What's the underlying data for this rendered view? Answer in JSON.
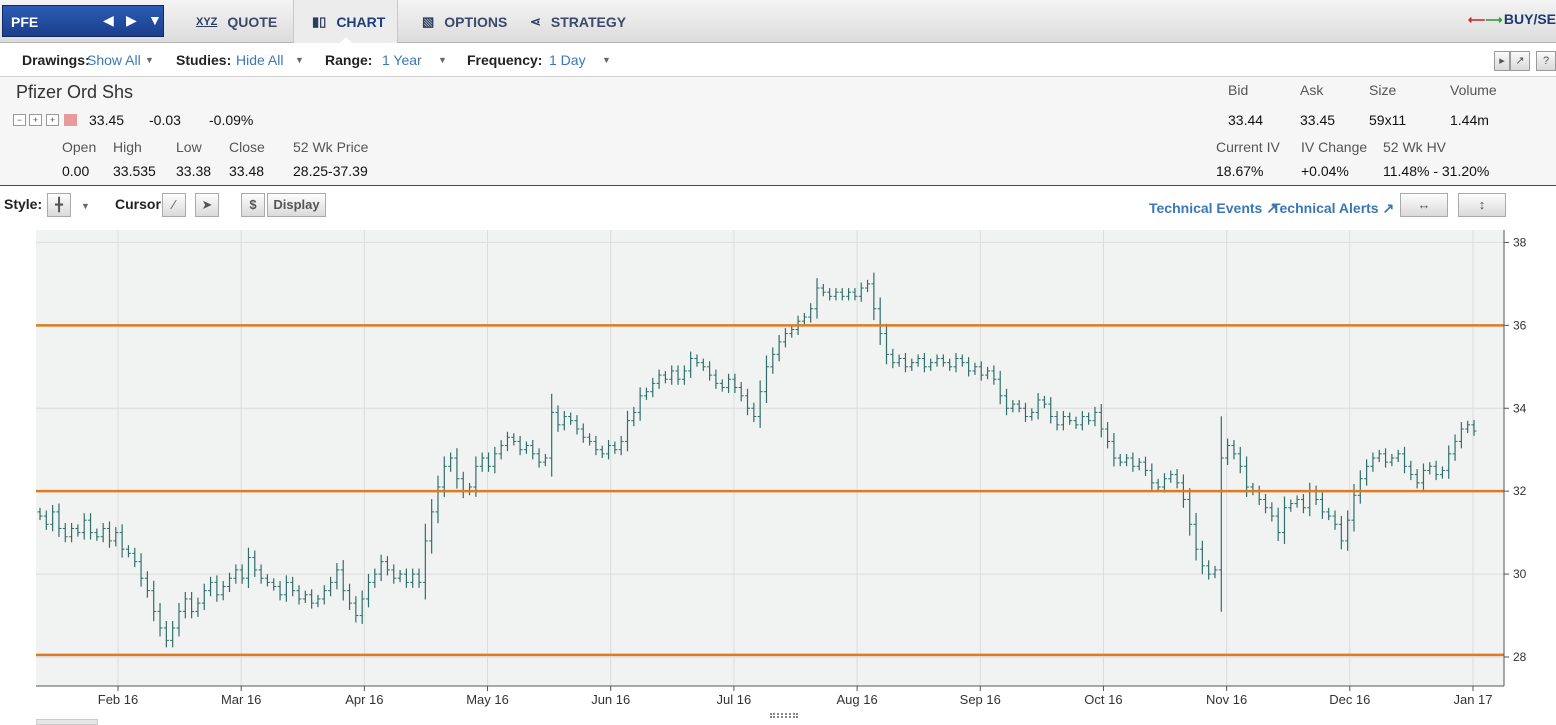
{
  "symbol": {
    "ticker": "PFE"
  },
  "nav": {
    "tabs": [
      {
        "label": "QUOTE",
        "icon": "xyz-quote-icon",
        "active": false
      },
      {
        "label": "CHART",
        "icon": "bar-chart-icon",
        "active": true
      },
      {
        "label": "OPTIONS",
        "icon": "options-icon",
        "active": false
      },
      {
        "label": "STRATEGY",
        "icon": "strategy-icon",
        "active": false
      }
    ],
    "buy_sell": "BUY/SEL"
  },
  "toolbar": {
    "drawings_label": "Drawings:",
    "drawings_value": "Show All",
    "studies_label": "Studies:",
    "studies_value": "Hide All",
    "range_label": "Range:",
    "range_value": "1 Year",
    "frequency_label": "Frequency:",
    "frequency_value": "1 Day"
  },
  "quote": {
    "name": "Pfizer Ord Shs",
    "last": "33.45",
    "change": "-0.03",
    "change_pct": "-0.09%",
    "open_label": "Open",
    "open": "0.00",
    "high_label": "High",
    "high": "33.535",
    "low_label": "Low",
    "low": "33.38",
    "close_label": "Close",
    "close": "33.48",
    "wk52_label": "52 Wk Price",
    "wk52": "28.25-37.39",
    "bid_label": "Bid",
    "bid": "33.44",
    "ask_label": "Ask",
    "ask": "33.45",
    "size_label": "Size",
    "size": "59x11",
    "volume_label": "Volume",
    "volume": "1.44m",
    "iv_label": "Current IV",
    "iv": "18.67%",
    "ivchg_label": "IV Change",
    "ivchg": "+0.04%",
    "hv_label": "52 Wk HV",
    "hv": "11.48% - 31.20%"
  },
  "chart_tools": {
    "style_label": "Style:",
    "cursor_label": "Cursor:",
    "dollar_label": "$",
    "display_label": "Display",
    "technical_events": "Technical Events",
    "technical_alerts": "Technical Alerts"
  },
  "colors": {
    "bar": "#2f6f6a",
    "line": "#e07a22",
    "plot_bg": "#f1f2f2",
    "grid": "#dcdcdc"
  },
  "chart_data": {
    "type": "ohlc",
    "ylim": [
      27.3,
      38.3
    ],
    "yticks": [
      28,
      30,
      32,
      34,
      36,
      38
    ],
    "xticks": [
      "Feb 16",
      "Mar 16",
      "Apr 16",
      "May 16",
      "Jun 16",
      "Jul 16",
      "Aug 16",
      "Sep 16",
      "Oct 16",
      "Nov 16",
      "Dec 16",
      "Jan 17"
    ],
    "horizontal_lines": [
      36.0,
      32.0,
      28.05
    ],
    "closes": [
      31.4,
      31.2,
      31.5,
      31.1,
      30.9,
      31.1,
      31.0,
      31.3,
      31.0,
      30.9,
      31.1,
      30.8,
      31.0,
      30.6,
      30.5,
      30.3,
      29.9,
      29.6,
      29.1,
      28.7,
      28.4,
      28.7,
      29.1,
      29.4,
      29.1,
      29.3,
      29.6,
      29.8,
      29.5,
      29.7,
      29.9,
      30.1,
      29.9,
      30.4,
      30.1,
      29.9,
      29.8,
      29.7,
      29.5,
      29.8,
      29.6,
      29.4,
      29.5,
      29.3,
      29.4,
      29.6,
      29.8,
      30.1,
      29.6,
      29.3,
      29.0,
      29.4,
      29.8,
      30.0,
      30.3,
      30.1,
      29.9,
      30.0,
      29.8,
      30.0,
      29.8,
      30.8,
      31.5,
      32.1,
      32.6,
      32.8,
      32.3,
      32.0,
      32.1,
      32.6,
      32.8,
      32.6,
      32.9,
      33.1,
      33.3,
      33.2,
      33.0,
      33.1,
      32.9,
      32.7,
      32.8,
      33.9,
      33.6,
      33.8,
      33.7,
      33.5,
      33.3,
      33.2,
      33.0,
      32.9,
      33.1,
      33.0,
      33.2,
      33.7,
      33.9,
      34.3,
      34.4,
      34.6,
      34.8,
      34.7,
      34.9,
      34.7,
      34.9,
      35.2,
      35.1,
      35.0,
      34.8,
      34.6,
      34.5,
      34.7,
      34.5,
      34.3,
      34.0,
      33.8,
      34.4,
      35.0,
      35.3,
      35.6,
      35.8,
      35.9,
      36.1,
      36.2,
      36.4,
      36.9,
      36.8,
      36.7,
      36.8,
      36.7,
      36.8,
      36.7,
      36.9,
      37.0,
      36.4,
      35.8,
      35.3,
      35.1,
      35.2,
      35.0,
      35.1,
      35.2,
      35.0,
      35.1,
      35.2,
      35.1,
      35.0,
      35.2,
      35.1,
      34.9,
      35.0,
      34.8,
      34.9,
      34.7,
      34.3,
      34.0,
      34.1,
      34.0,
      33.8,
      33.9,
      34.2,
      34.1,
      33.8,
      33.6,
      33.8,
      33.7,
      33.6,
      33.8,
      33.7,
      33.9,
      33.5,
      33.2,
      32.8,
      32.7,
      32.8,
      32.6,
      32.7,
      32.5,
      32.2,
      32.1,
      32.3,
      32.4,
      32.2,
      31.8,
      31.2,
      30.6,
      30.2,
      30.0,
      30.1,
      32.8,
      33.1,
      32.9,
      32.6,
      32.1,
      32.0,
      31.8,
      31.6,
      31.4,
      31.0,
      31.6,
      31.7,
      31.8,
      31.6,
      32.0,
      31.8,
      31.5,
      31.4,
      31.2,
      30.8,
      31.3,
      31.9,
      32.3,
      32.6,
      32.8,
      32.9,
      32.7,
      32.8,
      32.9,
      32.6,
      32.4,
      32.2,
      32.5,
      32.6,
      32.4,
      32.5,
      32.9,
      33.2,
      33.5,
      33.6,
      33.45
    ]
  }
}
